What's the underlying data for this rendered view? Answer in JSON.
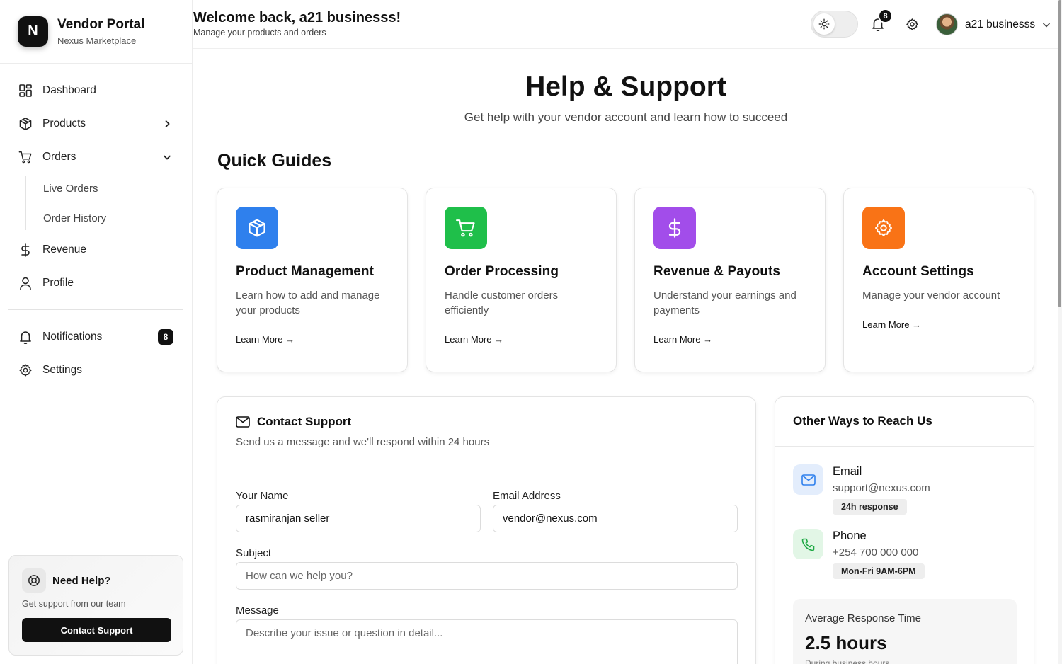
{
  "brand": {
    "logo_letter": "N",
    "title": "Vendor Portal",
    "subtitle": "Nexus Marketplace"
  },
  "sidebar": {
    "items": [
      {
        "label": "Dashboard",
        "icon": "dashboard-grid-icon"
      },
      {
        "label": "Products",
        "icon": "package-icon"
      },
      {
        "label": "Orders",
        "icon": "cart-icon"
      },
      {
        "label": "Revenue",
        "icon": "dollar-icon"
      },
      {
        "label": "Profile",
        "icon": "user-icon"
      }
    ],
    "order_subitems": [
      "Live Orders",
      "Order History"
    ],
    "notifications": {
      "label": "Notifications",
      "badge": "8"
    },
    "settings": {
      "label": "Settings"
    }
  },
  "help_card": {
    "title": "Need Help?",
    "subtitle": "Get support from our team",
    "button": "Contact Support"
  },
  "header": {
    "welcome": "Welcome back, a21 businesss!",
    "welcome_sub": "Manage your products and orders",
    "notification_count": "8",
    "user_name": "a21 businesss"
  },
  "page": {
    "title": "Help & Support",
    "subtitle": "Get help with your vendor account and learn how to succeed"
  },
  "quick_guides": {
    "title": "Quick Guides",
    "cards": [
      {
        "title": "Product Management",
        "desc": "Learn how to add and manage your products",
        "link": "Learn More →",
        "color": "#2f80ed",
        "icon": "package-icon"
      },
      {
        "title": "Order Processing",
        "desc": "Handle customer orders efficiently",
        "link": "Learn More →",
        "color": "#1fbf4a",
        "icon": "cart-icon"
      },
      {
        "title": "Revenue & Payouts",
        "desc": "Understand your earnings and payments",
        "link": "Learn More →",
        "color": "#a24dea",
        "icon": "dollar-icon"
      },
      {
        "title": "Account Settings",
        "desc": "Manage your vendor account",
        "link": "Learn More →",
        "color": "#f97316",
        "icon": "gear-icon"
      }
    ]
  },
  "contact": {
    "title": "Contact Support",
    "subtitle": "Send us a message and we'll respond within 24 hours",
    "name_label": "Your Name",
    "name_value": "rasmiranjan seller",
    "email_label": "Email Address",
    "email_value": "vendor@nexus.com",
    "subject_label": "Subject",
    "subject_placeholder": "How can we help you?",
    "message_label": "Message",
    "message_placeholder": "Describe your issue or question in detail..."
  },
  "reach": {
    "title": "Other Ways to Reach Us",
    "email": {
      "title": "Email",
      "value": "support@nexus.com",
      "tag": "24h response"
    },
    "phone": {
      "title": "Phone",
      "value": "+254 700 000 000",
      "tag": "Mon-Fri 9AM-6PM"
    },
    "avg": {
      "label": "Average Response Time",
      "value": "2.5 hours",
      "sub": "During business hours"
    }
  }
}
